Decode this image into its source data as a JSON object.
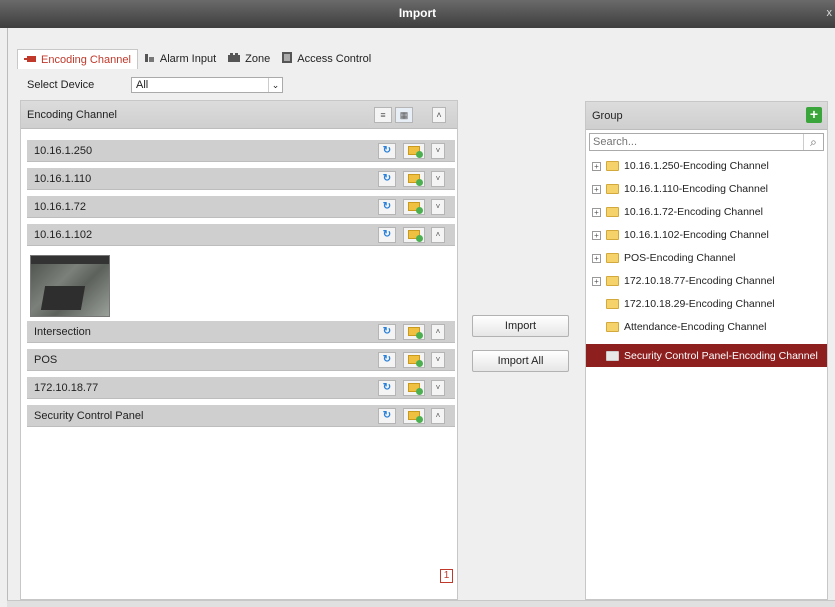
{
  "window": {
    "title": "Import",
    "close_glyph": "x"
  },
  "tabs": [
    {
      "label": "Encoding Channel",
      "icon": "camera-icon",
      "active": true
    },
    {
      "label": "Alarm Input",
      "icon": "alarm-input-icon",
      "active": false
    },
    {
      "label": "Zone",
      "icon": "zone-icon",
      "active": false
    },
    {
      "label": "Access Control",
      "icon": "access-control-icon",
      "active": false
    }
  ],
  "select_device": {
    "label": "Select Device",
    "value": "All"
  },
  "left_panel": {
    "title": "Encoding Channel",
    "rows": [
      {
        "name": "10.16.1.250",
        "expanded": false
      },
      {
        "name": "10.16.1.110",
        "expanded": false
      },
      {
        "name": "10.16.1.72",
        "expanded": false
      },
      {
        "name": "10.16.1.102",
        "expanded": true
      },
      {
        "name": "Intersection",
        "expanded": true
      },
      {
        "name": "POS",
        "expanded": false
      },
      {
        "name": "172.10.18.77",
        "expanded": false
      },
      {
        "name": "Security Control Panel",
        "expanded": true
      }
    ],
    "page": "1"
  },
  "buttons": {
    "import": "Import",
    "import_all": "Import All"
  },
  "right_panel": {
    "title": "Group",
    "search_placeholder": "Search...",
    "items": [
      {
        "label": "10.16.1.250-Encoding Channel",
        "expandable": true,
        "selected": false
      },
      {
        "label": "10.16.1.110-Encoding Channel",
        "expandable": true,
        "selected": false
      },
      {
        "label": "10.16.1.72-Encoding Channel",
        "expandable": true,
        "selected": false
      },
      {
        "label": "10.16.1.102-Encoding Channel",
        "expandable": true,
        "selected": false
      },
      {
        "label": "POS-Encoding Channel",
        "expandable": true,
        "selected": false
      },
      {
        "label": "172.10.18.77-Encoding Channel",
        "expandable": true,
        "selected": false
      },
      {
        "label": "172.10.18.29-Encoding Channel",
        "expandable": false,
        "selected": false
      },
      {
        "label": "Attendance-Encoding Channel",
        "expandable": false,
        "selected": false
      },
      {
        "label": "Security Control Panel-Encoding Channel",
        "expandable": false,
        "selected": true
      }
    ]
  },
  "colors": {
    "accent": "#c0392b",
    "selected_row": "#8d1f1f",
    "titlebar": "#4a4a4a"
  }
}
